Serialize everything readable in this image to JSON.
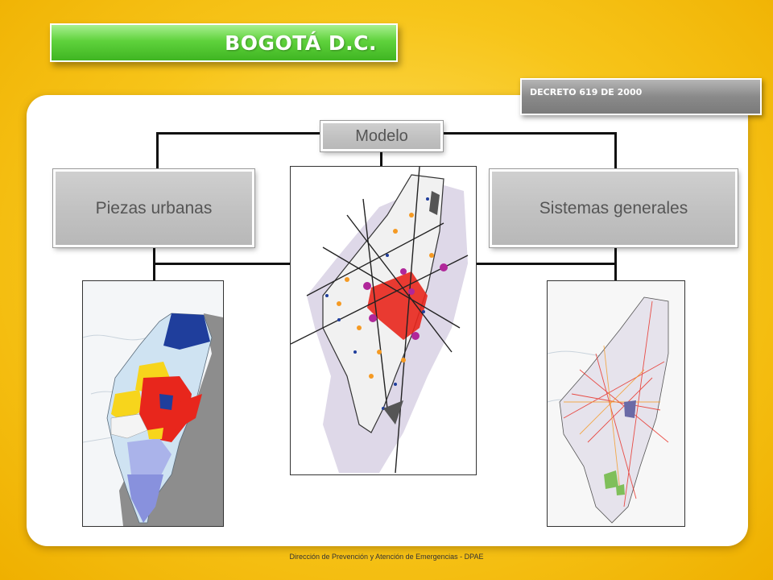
{
  "header": {
    "title": "BOGOTÁ D.C."
  },
  "decree": {
    "label": "DECRETO 619 DE 2000"
  },
  "diagram": {
    "center_label": "Modelo",
    "left_label": "Piezas urbanas",
    "right_label": "Sistemas generales"
  },
  "footer": {
    "text": "Dirección de Prevención y Atención de Emergencias - DPAE"
  },
  "colors": {
    "background": "#f7c51a",
    "title_bar": "#4cc22d",
    "box_gray": "#c4c4c4",
    "map_red": "#e8261c",
    "map_blue": "#1f3e9c",
    "map_orange": "#f59a23",
    "map_purple": "#b0279a"
  }
}
